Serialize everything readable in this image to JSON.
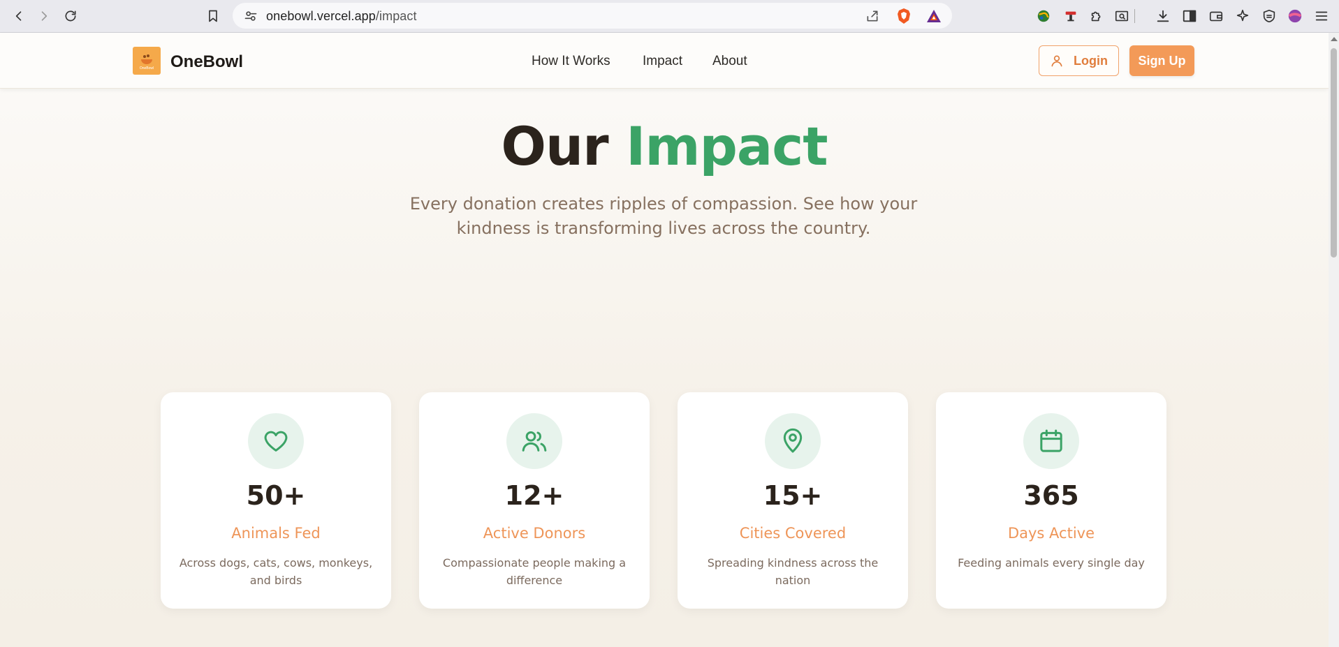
{
  "browser": {
    "url_host": "onebowl.vercel.app",
    "url_path": "/impact"
  },
  "site": {
    "brand": "OneBowl",
    "logo_text": "OneBowl",
    "nav": [
      {
        "label": "How It Works"
      },
      {
        "label": "Impact"
      },
      {
        "label": "About"
      }
    ],
    "login_label": "Login",
    "signup_label": "Sign Up"
  },
  "hero": {
    "title_main": "Our",
    "title_accent": "Impact",
    "subtitle": "Every donation creates ripples of compassion. See how your kindness is transforming lives across the country."
  },
  "stats": [
    {
      "icon": "heart-icon",
      "value": "50+",
      "label": "Animals Fed",
      "desc": "Across dogs, cats, cows, monkeys, and birds"
    },
    {
      "icon": "users-icon",
      "value": "12+",
      "label": "Active Donors",
      "desc": "Compassionate people making a difference"
    },
    {
      "icon": "map-pin-icon",
      "value": "15+",
      "label": "Cities Covered",
      "desc": "Spreading kindness across the nation"
    },
    {
      "icon": "calendar-icon",
      "value": "365",
      "label": "Days Active",
      "desc": "Feeding animals every single day"
    }
  ],
  "colors": {
    "accent_green": "#3ba366",
    "accent_orange": "#f39a58",
    "icon_bg": "#e7f3ec"
  }
}
